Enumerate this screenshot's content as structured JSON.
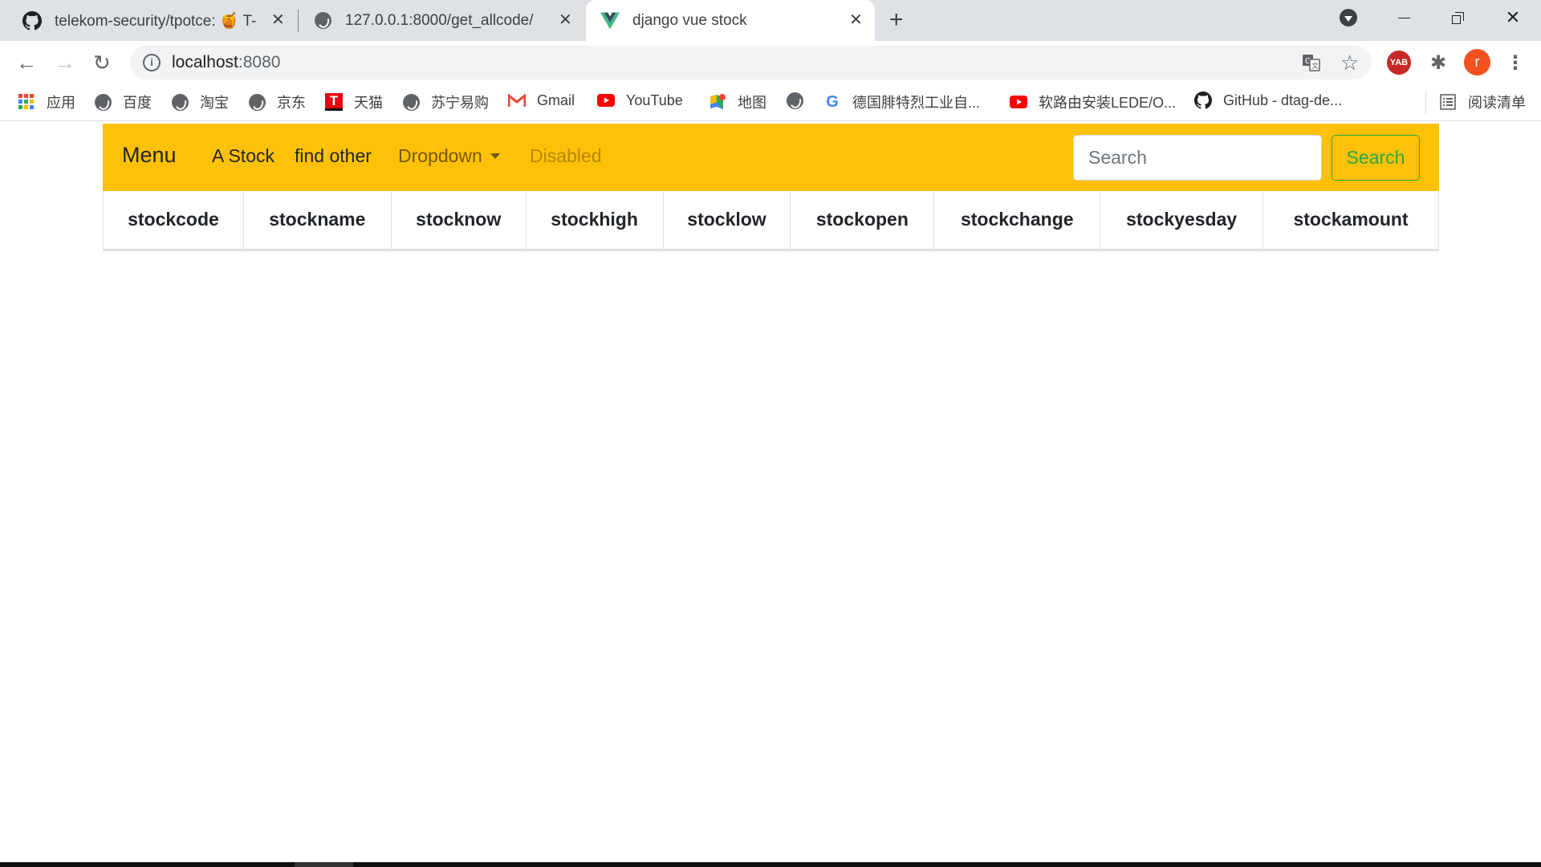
{
  "browser": {
    "tabs": [
      {
        "title": "telekom-security/tpotce: 🍯 T-",
        "icon": "github-icon",
        "active": false
      },
      {
        "title": "127.0.0.1:8000/get_allcode/",
        "icon": "globe-icon",
        "active": false
      },
      {
        "title": "django vue stock",
        "icon": "vue-logo-icon",
        "active": true
      }
    ],
    "close_glyph": "✕",
    "new_tab_glyph": "+",
    "address": {
      "host": "localhost",
      "port": ":8080"
    },
    "profile_initial": "r",
    "extension_label": "YAB",
    "bookmarks": [
      {
        "label": "应用",
        "icon": "apps-grid-icon"
      },
      {
        "label": "百度",
        "icon": "globe-icon"
      },
      {
        "label": "淘宝",
        "icon": "globe-icon"
      },
      {
        "label": "京东",
        "icon": "globe-icon"
      },
      {
        "label": "天猫",
        "icon": "tmall-icon"
      },
      {
        "label": "苏宁易购",
        "icon": "globe-icon"
      },
      {
        "label": "Gmail",
        "icon": "gmail-icon"
      },
      {
        "label": "YouTube",
        "icon": "youtube-icon"
      },
      {
        "label": "地图",
        "icon": "maps-icon"
      },
      {
        "label": "",
        "icon": "globe-icon"
      },
      {
        "label": "德国腓特烈工业自...",
        "icon": "google-icon"
      },
      {
        "label": "软路由安装LEDE/O...",
        "icon": "youtube-icon"
      },
      {
        "label": "GitHub - dtag-de...",
        "icon": "github-icon"
      }
    ],
    "reading_list": "阅读清单"
  },
  "navbar": {
    "brand": "Menu",
    "links": [
      {
        "label": "A Stock",
        "state": "active"
      },
      {
        "label": "find other",
        "state": "active"
      },
      {
        "label": "Dropdown",
        "state": "muted"
      },
      {
        "label": "Disabled",
        "state": "disabled"
      }
    ],
    "search": {
      "placeholder": "Search",
      "value": "",
      "button_label": "Search"
    },
    "colors": {
      "background": "#ffc107",
      "search_button": "#28a745"
    }
  },
  "table": {
    "columns": [
      "stockcode",
      "stockname",
      "stocknow",
      "stockhigh",
      "stocklow",
      "stockopen",
      "stockchange",
      "stockyesday",
      "stockamount"
    ],
    "rows": []
  }
}
